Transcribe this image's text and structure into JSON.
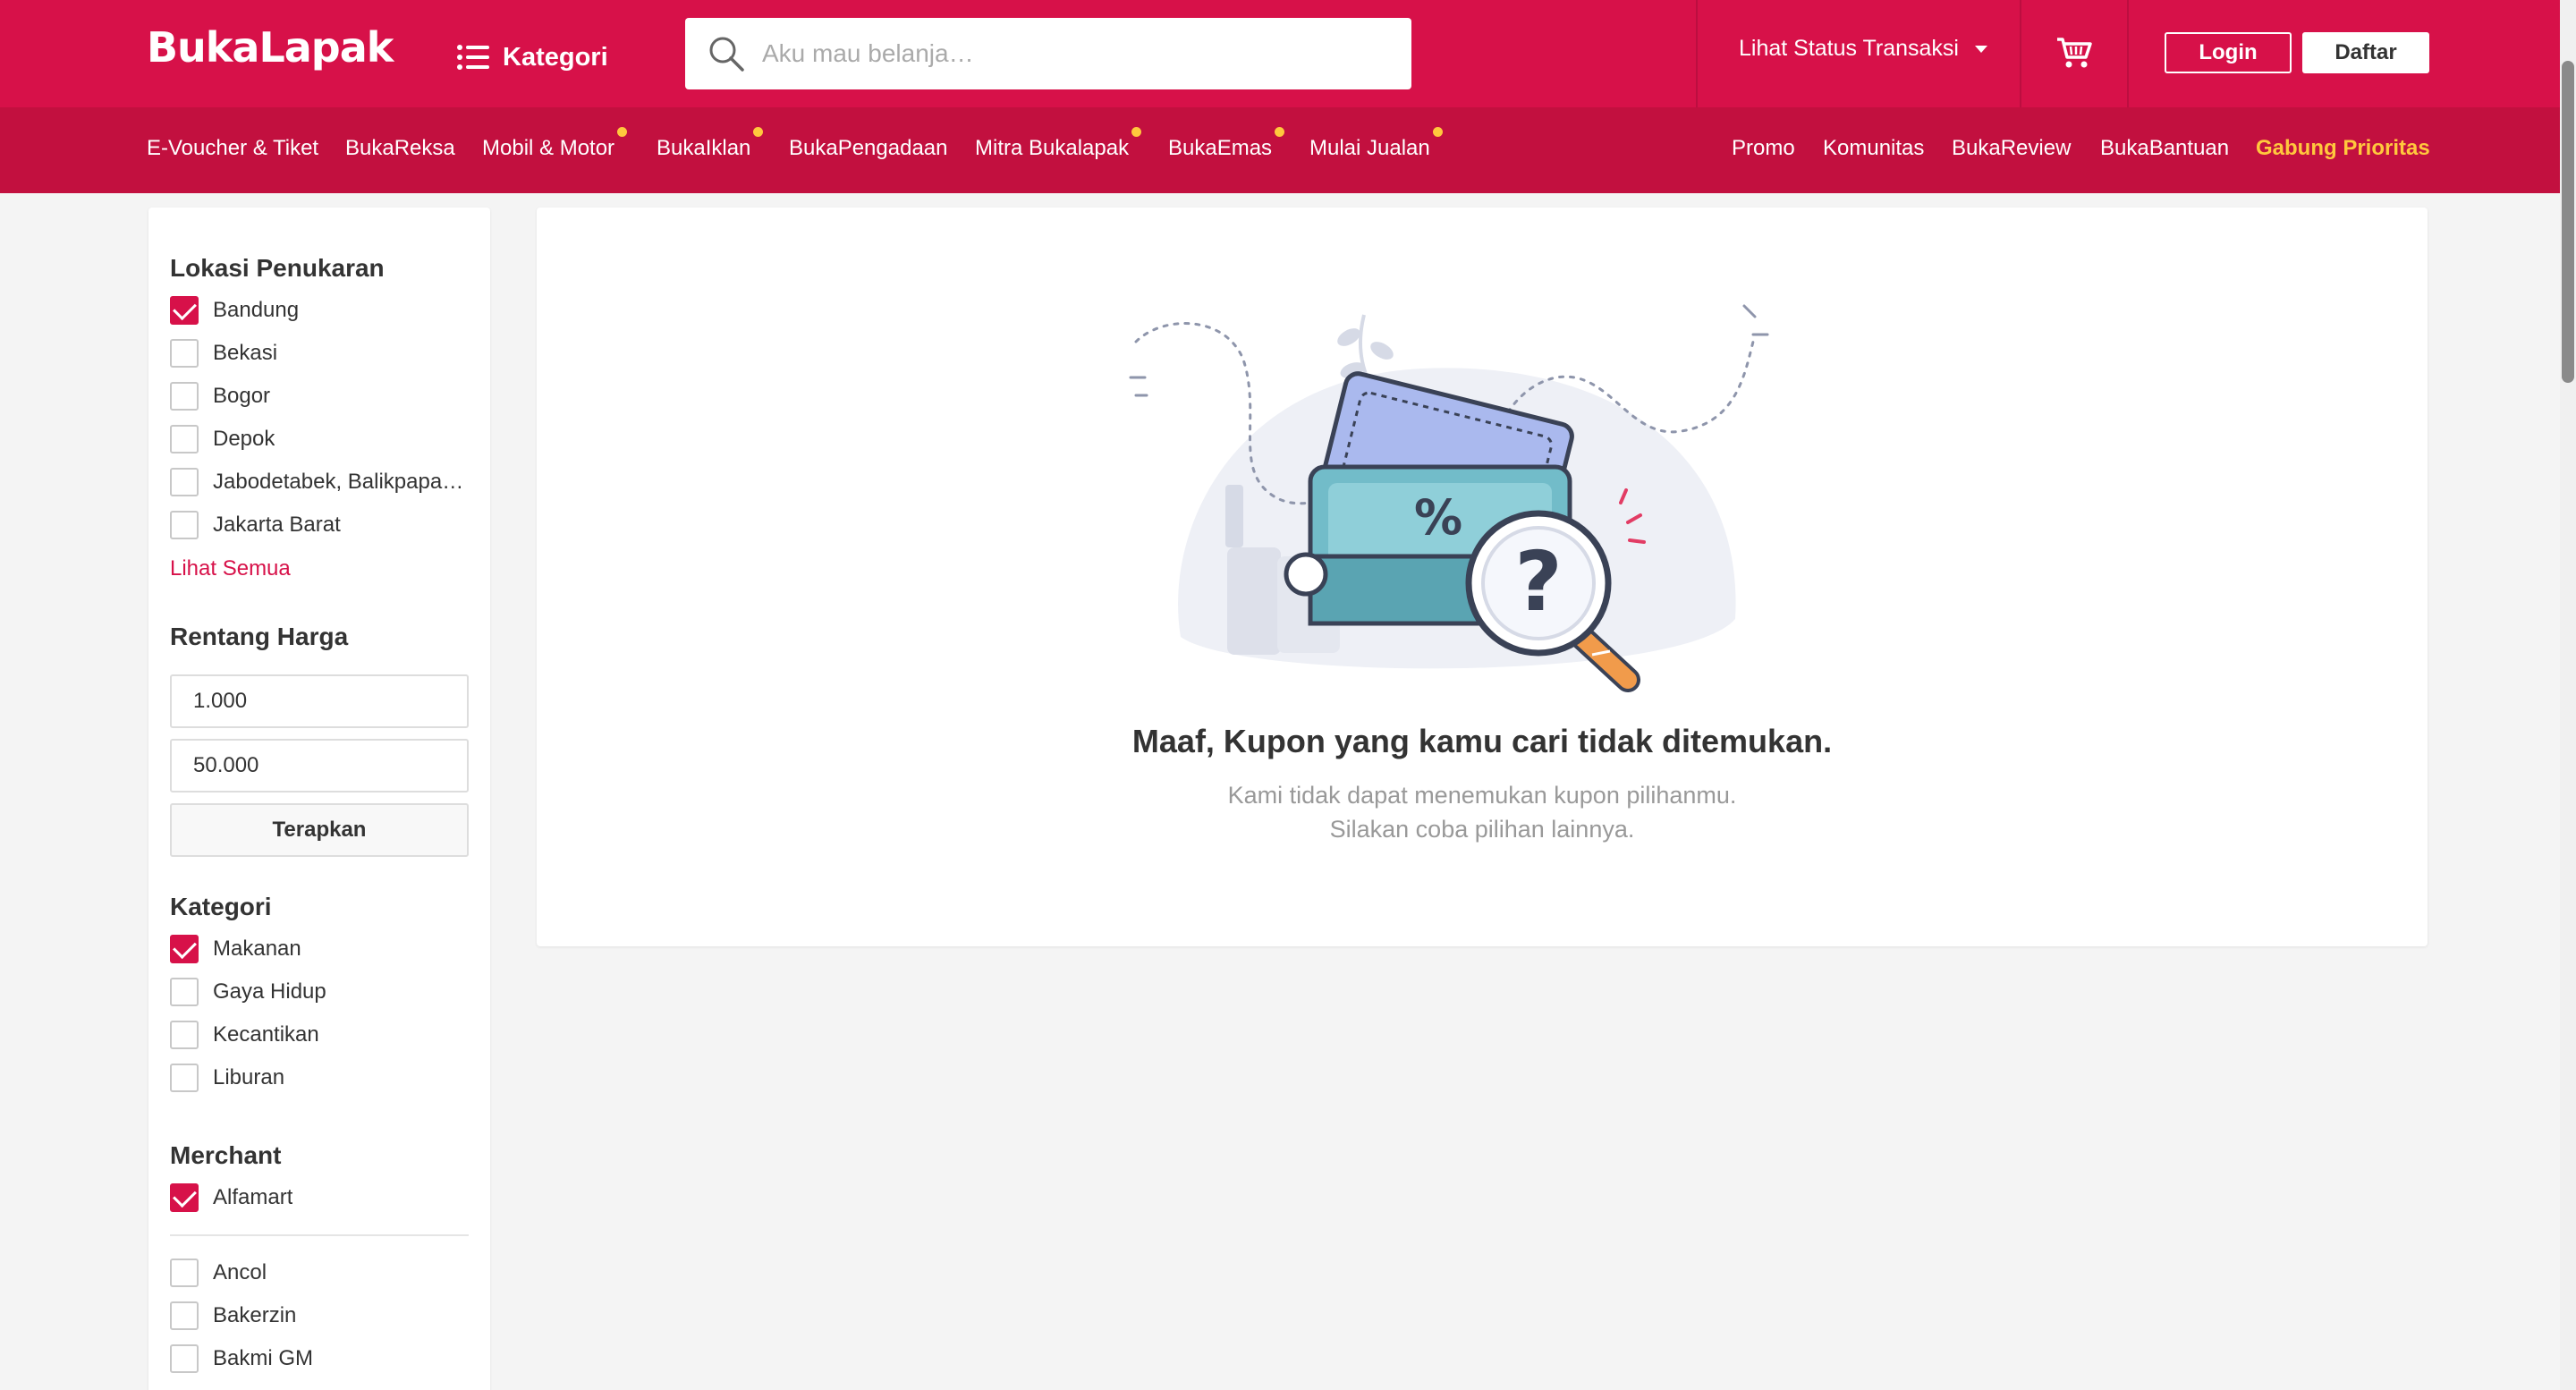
{
  "header": {
    "logo_text": "BukaLapak",
    "kategori_label": "Kategori",
    "search_placeholder": "Aku mau belanja…",
    "status_label": "Lihat Status Transaksi",
    "login_label": "Login",
    "daftar_label": "Daftar"
  },
  "subnav": {
    "left": [
      "E-Voucher & Tiket",
      "BukaReksa",
      "Mobil & Motor",
      "BukaIklan",
      "BukaPengadaan",
      "Mitra Bukalapak",
      "BukaEmas",
      "Mulai Jualan"
    ],
    "right": [
      "Promo",
      "Komunitas",
      "BukaReview",
      "BukaBantuan",
      "Gabung Prioritas"
    ]
  },
  "sidebar": {
    "lokasi_title": "Lokasi Penukaran",
    "lokasi": [
      "Bandung",
      "Bekasi",
      "Bogor",
      "Depok",
      "Jabodetabek, Balikpapan, Bandung",
      "Jakarta Barat"
    ],
    "lokasi_checked": [
      "Bandung"
    ],
    "see_all": "Lihat Semua",
    "harga_title": "Rentang Harga",
    "harga_min": "1.000",
    "harga_max": "50.000",
    "apply_label": "Terapkan",
    "kategori_title": "Kategori",
    "kategori": [
      "Makanan",
      "Gaya Hidup",
      "Kecantikan",
      "Liburan"
    ],
    "kategori_checked": [
      "Makanan"
    ],
    "merchant_title": "Merchant",
    "merchant_selected": [
      "Alfamart"
    ],
    "merchant": [
      "Ancol",
      "Bakerzin",
      "Bakmi GM"
    ]
  },
  "main": {
    "empty_title": "Maaf, Kupon yang kamu cari tidak ditemukan.",
    "empty_line1": "Kami tidak dapat menemukan kupon pilihanmu.",
    "empty_line2": "Silakan coba pilihan lainnya."
  },
  "colors": {
    "brand": "#d71149",
    "brand_dark": "#c2103f",
    "highlight": "#ffc83d"
  }
}
